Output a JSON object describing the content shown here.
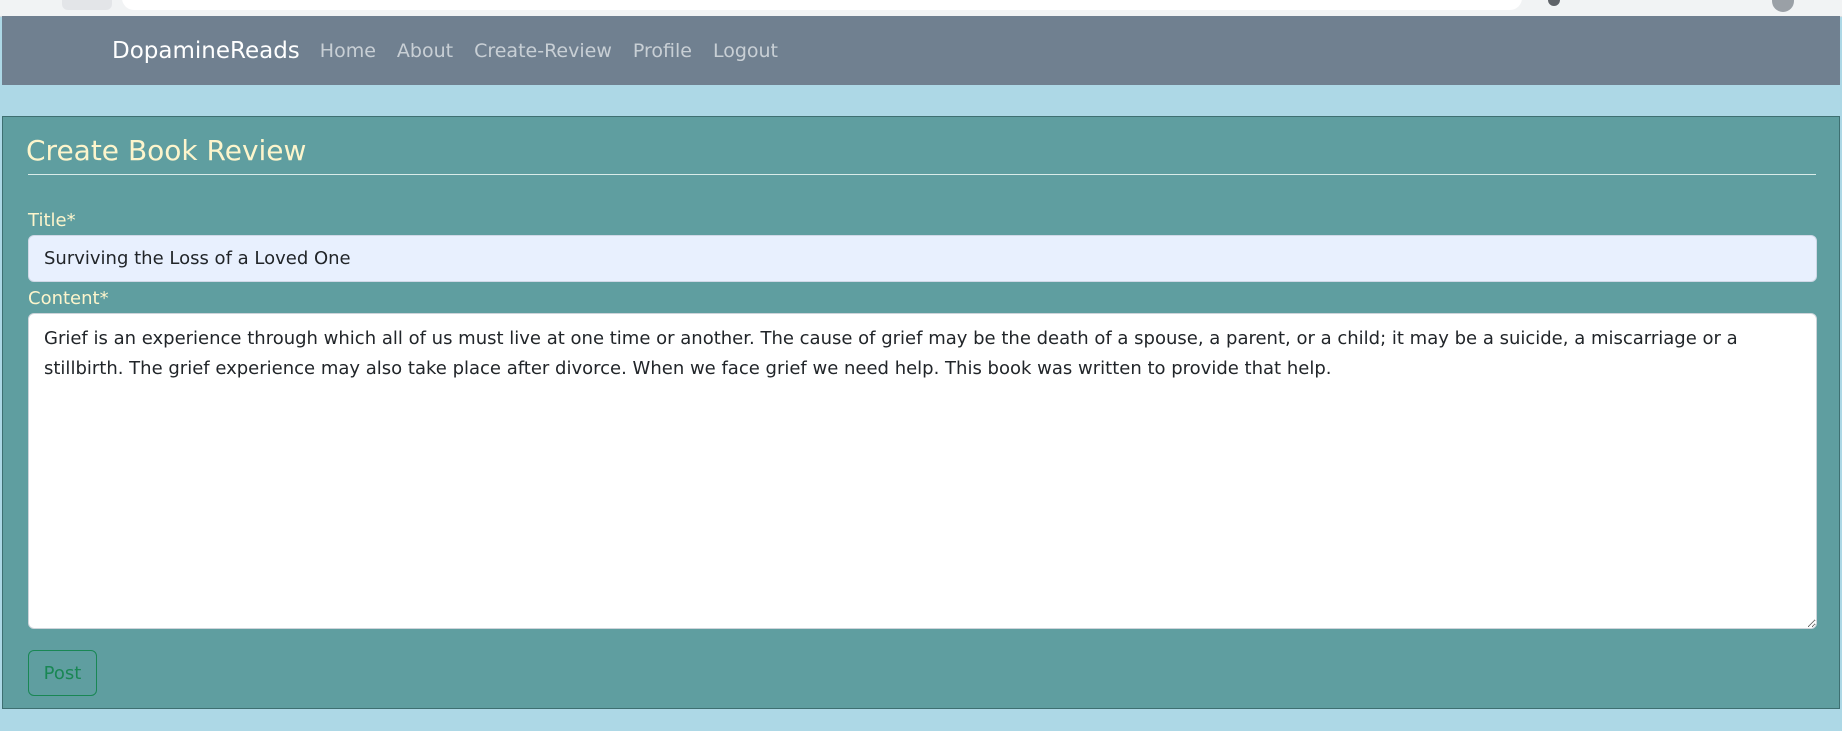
{
  "navbar": {
    "brand": "DopamineReads",
    "links": [
      {
        "label": "Home"
      },
      {
        "label": "About"
      },
      {
        "label": "Create-Review"
      },
      {
        "label": "Profile"
      },
      {
        "label": "Logout"
      }
    ],
    "background_color": "#708090"
  },
  "page": {
    "title": "Create Book Review",
    "background_color": "#add8e6",
    "card_color": "#5f9ea0"
  },
  "form": {
    "title_label": "Title*",
    "title_value": "Surviving the Loss of a Loved One",
    "content_label": "Content*",
    "content_value": "Grief is an experience through which all of us must live at one time or another. The cause of grief may be the death of a spouse, a parent, or a child; it may be a suicide, a miscarriage or a stillbirth. The grief experience may also take place after divorce. When we face grief we need help. This book was written to provide that help.",
    "submit_label": "Post",
    "submit_color": "#198754"
  }
}
